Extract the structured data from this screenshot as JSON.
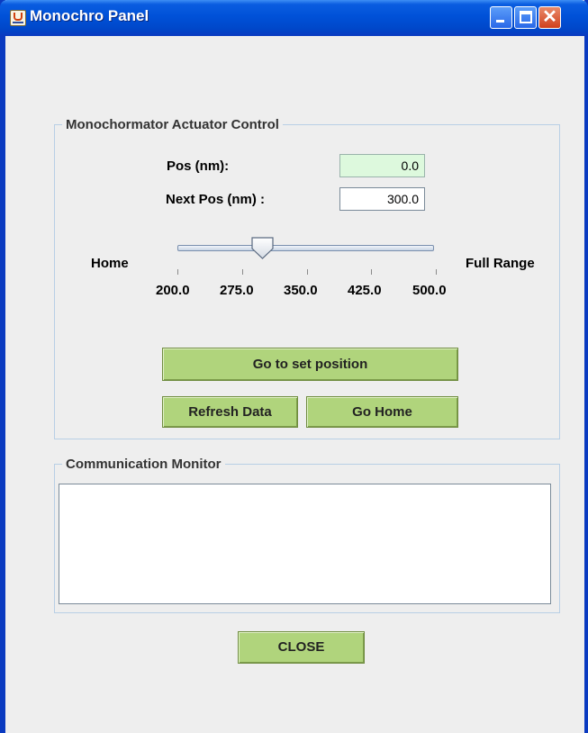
{
  "window": {
    "title": "Monochro Panel",
    "icon": "java-app-icon"
  },
  "controls": {
    "minimize": "minimize-icon",
    "maximize": "maximize-icon",
    "close": "close-icon",
    "close_glyph": "✕"
  },
  "actuator": {
    "legend": "Monochormator Actuator Control",
    "pos_label": "Pos  (nm):",
    "pos_value": "0.0",
    "next_label": "Next Pos (nm) :",
    "next_value": "300.0",
    "home_label": "Home",
    "full_range_label": "Full Range",
    "slider": {
      "min": 200,
      "max": 500,
      "value": 300
    },
    "ticks": [
      "200.0",
      "275.0",
      "350.0",
      "425.0",
      "500.0"
    ],
    "goto_button": "Go to set position",
    "refresh_button": "Refresh Data",
    "home_button": "Go Home"
  },
  "monitor": {
    "legend": "Communication Monitor",
    "text": ""
  },
  "close_button": "CLOSE",
  "colors": {
    "button_green": "#b0d47c",
    "pos_field_bg": "#ddf9dd",
    "title_blue": "#0051d8"
  }
}
